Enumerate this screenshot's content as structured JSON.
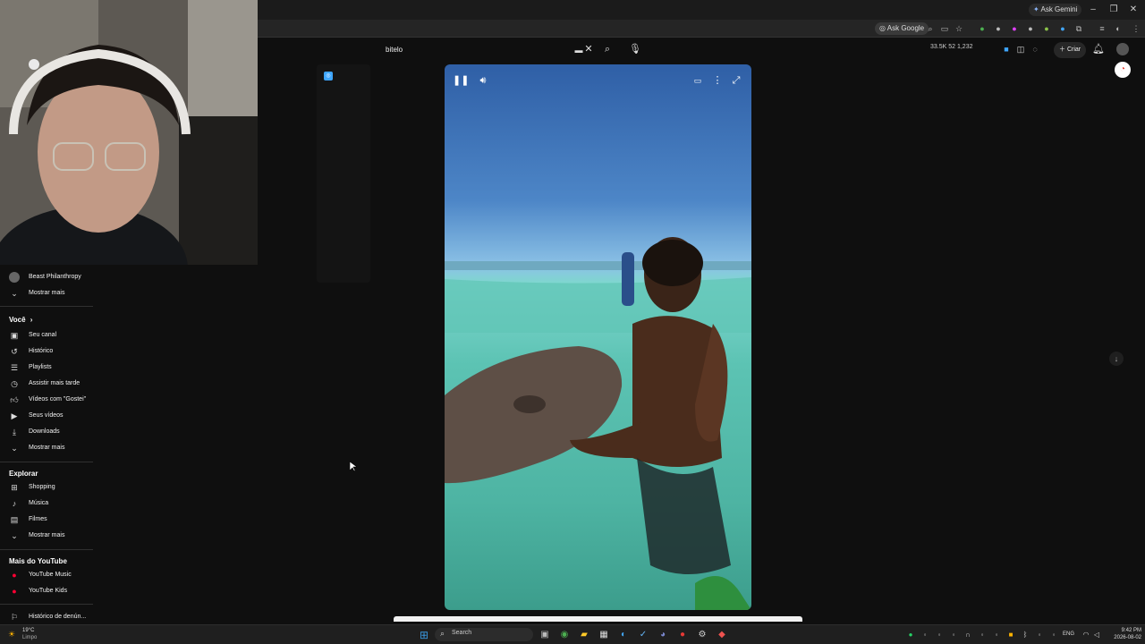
{
  "browser": {
    "ask_gemini": "Ask Gemini",
    "ask_google": "Ask Google"
  },
  "youtube": {
    "search_value": "bitelo",
    "stats": "33.5K  52  1,232",
    "create_label": "Criar"
  },
  "sidebar": {
    "subscriptions": [
      {
        "label": "Beast Philanthropy",
        "icon": "channel-avatar-icon"
      },
      {
        "label": "Mostrar mais",
        "icon": "chevron-down-icon"
      }
    ],
    "you_header": "Você",
    "you_items": [
      {
        "label": "Seu canal",
        "icon": "account-icon"
      },
      {
        "label": "Histórico",
        "icon": "history-icon"
      },
      {
        "label": "Playlists",
        "icon": "playlist-icon"
      },
      {
        "label": "Assistir mais tarde",
        "icon": "clock-icon"
      },
      {
        "label": "Vídeos com \"Gostei\"",
        "icon": "thumbs-up-icon"
      },
      {
        "label": "Seus vídeos",
        "icon": "video-icon"
      },
      {
        "label": "Downloads",
        "icon": "download-icon"
      },
      {
        "label": "Mostrar mais",
        "icon": "chevron-down-icon"
      }
    ],
    "explore_header": "Explorar",
    "explore_items": [
      {
        "label": "Shopping",
        "icon": "shopping-bag-icon"
      },
      {
        "label": "Música",
        "icon": "music-note-icon"
      },
      {
        "label": "Filmes",
        "icon": "film-icon"
      },
      {
        "label": "Mostrar mais",
        "icon": "chevron-down-icon"
      }
    ],
    "more_header": "Mais do YouTube",
    "more_items": [
      {
        "label": "YouTube Music",
        "icon": "youtube-music-icon"
      },
      {
        "label": "YouTube Kids",
        "icon": "youtube-kids-icon"
      },
      {
        "label": "Histórico de denún...",
        "icon": "flag-icon"
      }
    ]
  },
  "taskbar": {
    "weather_temp": "19°C",
    "weather_desc": "Limpo",
    "search_label": "Search",
    "lang": "ENG",
    "time": "9:42 PM",
    "date": "2026-08-02"
  },
  "colors": {
    "accent": "#3ea6ff",
    "youtube_red": "#ff0033",
    "background": "#0f0f0f"
  }
}
